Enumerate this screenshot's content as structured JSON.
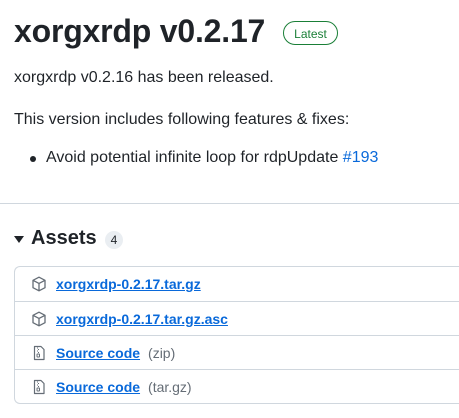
{
  "release": {
    "title": "xorgxrdp v0.2.17",
    "badge": "Latest"
  },
  "body": {
    "paragraph1": "xorgxrdp v0.2.16 has been released.",
    "paragraph2": "This version includes following features & fixes:",
    "bullets": [
      {
        "text": "Avoid potential infinite loop for rdpUpdate ",
        "link": "#193"
      }
    ]
  },
  "assets": {
    "title": "Assets",
    "count": "4",
    "items": [
      {
        "icon": "package-icon",
        "name": "xorgxrdp-0.2.17.tar.gz",
        "suffix": ""
      },
      {
        "icon": "package-icon",
        "name": "xorgxrdp-0.2.17.tar.gz.asc",
        "suffix": ""
      },
      {
        "icon": "file-zip-icon",
        "name": "Source code",
        "suffix": "(zip)"
      },
      {
        "icon": "file-zip-icon",
        "name": "Source code",
        "suffix": "(tar.gz)"
      }
    ]
  },
  "colors": {
    "link": "#0969da",
    "badge_green": "#1a7f37",
    "muted": "#656d76",
    "border": "#d0d7de"
  }
}
